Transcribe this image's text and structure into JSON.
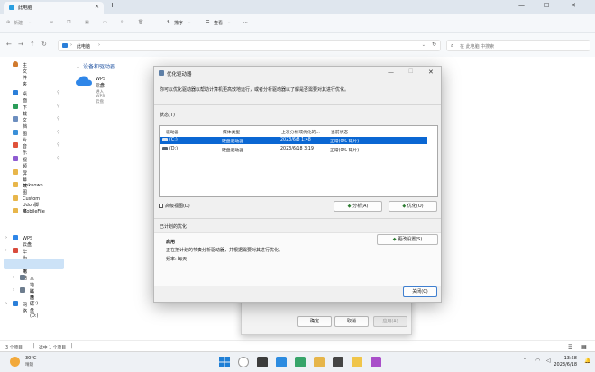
{
  "window": {
    "tab_title": "此电脑",
    "new_tab": "+",
    "minimize": "—",
    "maximize": "☐",
    "close": "✕"
  },
  "commandbar": {
    "new_label": "新建",
    "sort_label": "排序",
    "view_label": "查看",
    "more": "···"
  },
  "address": {
    "path": "此电脑",
    "search_placeholder": "在 此电脑 中搜索"
  },
  "sidebar": {
    "home": "主文件夹",
    "quick": [
      {
        "label": "桌面",
        "color": "#2b7fd9"
      },
      {
        "label": "下载",
        "color": "#2a9d59"
      },
      {
        "label": "文档",
        "color": "#6c8ebf"
      },
      {
        "label": "图片",
        "color": "#3a8fd8"
      },
      {
        "label": "音乐",
        "color": "#e0523a"
      },
      {
        "label": "视频",
        "color": "#8e5bd1"
      },
      {
        "label": "屏幕截图",
        "color": "#e8b64a"
      },
      {
        "label": "unknown",
        "color": "#e8b64a"
      },
      {
        "label": "Custom Udon脚本",
        "color": "#e8b64a"
      },
      {
        "label": "MobileFile",
        "color": "#e8b64a"
      }
    ],
    "tree": [
      {
        "label": "WPS云盘"
      },
      {
        "label": "华为云盘"
      },
      {
        "label": "此电脑"
      },
      {
        "label": "本地磁盘 (C:)"
      },
      {
        "label": "本地磁盘 (D:)"
      },
      {
        "label": "网络"
      }
    ]
  },
  "content": {
    "section": "设备和驱动器",
    "wps_name": "WPS云盘",
    "wps_desc": "双击进入WPS云盘"
  },
  "status": {
    "count": "3 个项目",
    "selected": "选中 1 个项目"
  },
  "taskbar": {
    "temp": "30°C",
    "condition": "晴朗",
    "time": "13:58",
    "date": "2023/6/18"
  },
  "back_dialog": {
    "ok": "确定",
    "cancel": "取消",
    "apply": "应用(A)"
  },
  "dialog": {
    "title": "优化驱动器",
    "description": "你可以优化驱动器以帮助计算机更高效地运行，或者分析驱动器以了解是否需要对其进行优化。",
    "status_label": "状态(T)",
    "columns": [
      "驱动器",
      "媒体类型",
      "上次分析或优化的...",
      "当前状态"
    ],
    "drives": [
      {
        "name": "(C:)",
        "type": "硬盘驱动器",
        "last": "2023/6/8 1:48",
        "status": "正常(0% 碎片)",
        "selected": true
      },
      {
        "name": "(D:)",
        "type": "硬盘驱动器",
        "last": "2023/6/18 3:19",
        "status": "正常(0% 碎片)",
        "selected": false
      }
    ],
    "advanced": "高级视图(D)",
    "analyze": "分析(A)",
    "optimize": "优化(O)",
    "scheduled_label": "已计划的优化",
    "enabled": "启用",
    "schedule_desc": "正在按计划的节奏分析驱动器，并根据需要对其进行优化。",
    "frequency": "频率: 每天",
    "change_settings": "更改设置(S)",
    "close_btn": "关闭(C)"
  }
}
